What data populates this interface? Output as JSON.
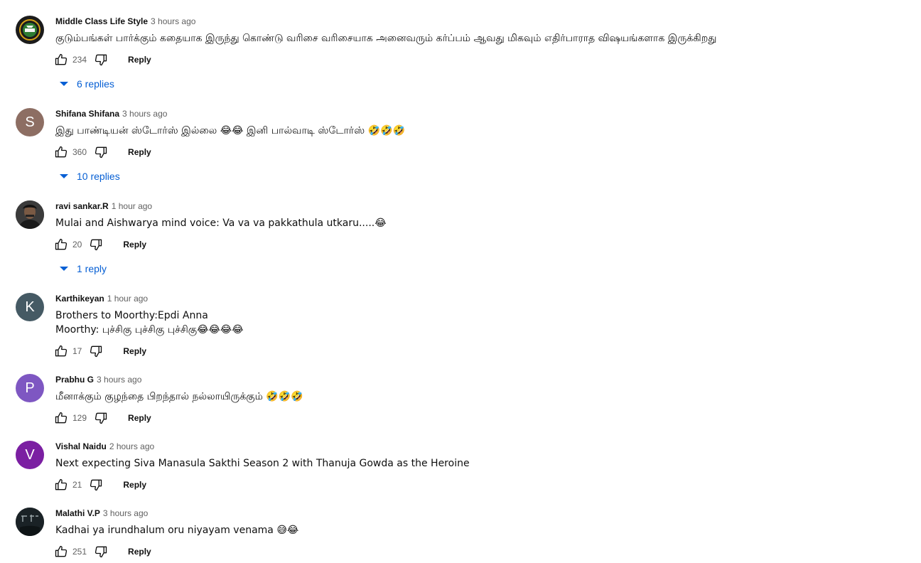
{
  "comments": [
    {
      "author": "Middle Class Life Style",
      "time": "3 hours ago",
      "text": "குடும்பங்கள் பார்க்கும் கதையாக இருந்து கொண்டு வரிசை வரிசையாக அனைவரும் கர்ப்பம் ஆவது மிகவும் எதிர்பாராத விஷயங்களாக இருக்கிறது",
      "likes": "234",
      "reply_label": "Reply",
      "replies_label": "6 replies",
      "avatar": {
        "type": "logo",
        "bg": "#1b1b1b"
      }
    },
    {
      "author": "Shifana Shifana",
      "time": "3 hours ago",
      "text": "இது பாண்டியன் ஸ்டோர்ஸ் இல்லை 😂😂  இனி பால்வாடி ஸ்டோர்ஸ் 🤣🤣🤣",
      "likes": "360",
      "reply_label": "Reply",
      "replies_label": "10 replies",
      "avatar": {
        "type": "letter",
        "letter": "S",
        "bg": "#8d6e63"
      }
    },
    {
      "author": "ravi sankar.R",
      "time": "1 hour ago",
      "text": "Mulai and  Aishwarya mind voice: Va va va pakkathula utkaru.....😂",
      "likes": "20",
      "reply_label": "Reply",
      "replies_label": "1 reply",
      "avatar": {
        "type": "photo",
        "bg": "#2a2a2a"
      }
    },
    {
      "author": "Karthikeyan",
      "time": "1 hour ago",
      "text": "Brothers to Moorthy:Epdi Anna\nMoorthy: புச்சிகு புச்சிகு புச்சிகு😂😂😂😂",
      "likes": "17",
      "reply_label": "Reply",
      "avatar": {
        "type": "letter",
        "letter": "K",
        "bg": "#455a64"
      }
    },
    {
      "author": "Prabhu G",
      "time": "3 hours ago",
      "text": "மீனாக்கும் குழந்தை பிறந்தால் நல்லாயிருக்கும் 🤣🤣🤣",
      "likes": "129",
      "reply_label": "Reply",
      "avatar": {
        "type": "letter",
        "letter": "P",
        "bg": "#7e57c2"
      }
    },
    {
      "author": "Vishal Naidu",
      "time": "2 hours ago",
      "text": "Next expecting Siva Manasula Sakthi Season 2 with Thanuja Gowda as the Heroine",
      "likes": "21",
      "reply_label": "Reply",
      "avatar": {
        "type": "letter",
        "letter": "V",
        "bg": "#7b1fa2"
      }
    },
    {
      "author": "Malathi V.P",
      "time": "3 hours ago",
      "text": "Kadhai ya irundhalum oru niyayam venama 😅😂",
      "likes": "251",
      "reply_label": "Reply",
      "avatar": {
        "type": "photo-dark",
        "bg": "#1a2226"
      }
    }
  ],
  "colors": {
    "link_blue": "#065fd4",
    "secondary_text": "#606060"
  },
  "icons": {
    "like": "thumbs-up-icon",
    "dislike": "thumbs-down-icon",
    "expand": "caret-down-icon"
  }
}
